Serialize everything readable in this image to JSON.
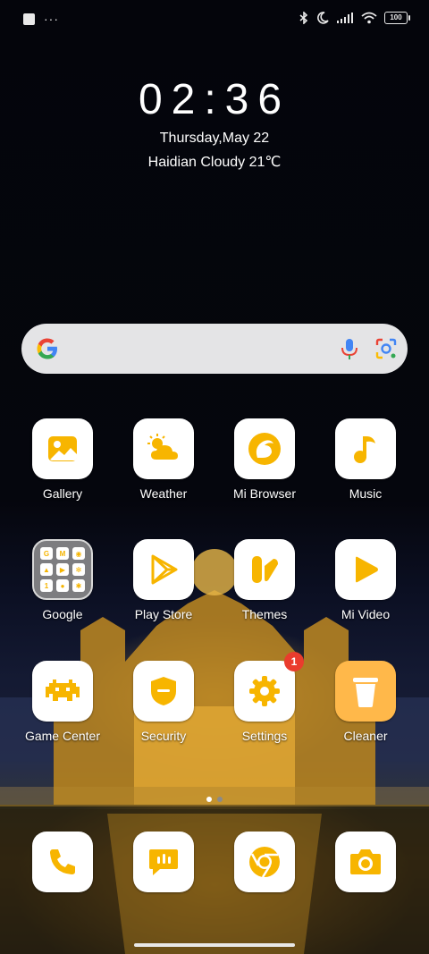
{
  "status_bar": {
    "battery": "100"
  },
  "lockinfo": {
    "time": "02:36",
    "date": "Thursday,May 22",
    "weather": "Haidian Cloudy 21℃"
  },
  "search": {
    "icons": [
      "google-g-icon",
      "microphone-icon",
      "google-lens-icon"
    ]
  },
  "apps_row1": [
    {
      "label": "Gallery"
    },
    {
      "label": "Weather"
    },
    {
      "label": "Mi Browser"
    },
    {
      "label": "Music"
    }
  ],
  "apps_row2": [
    {
      "label": "Google"
    },
    {
      "label": "Play Store"
    },
    {
      "label": "Themes"
    },
    {
      "label": "Mi Video"
    }
  ],
  "apps_row3": [
    {
      "label": "Game Center"
    },
    {
      "label": "Security"
    },
    {
      "label": "Settings",
      "badge": "1"
    },
    {
      "label": "Cleaner"
    }
  ],
  "dock": [
    "phone-icon",
    "messages-icon",
    "chrome-icon",
    "camera-icon"
  ],
  "colors": {
    "accent": "#F7B500",
    "badge": "#EA3C2D",
    "tile": "#FFFFFF"
  },
  "page_indicator": {
    "pages": 2,
    "current": 1
  }
}
